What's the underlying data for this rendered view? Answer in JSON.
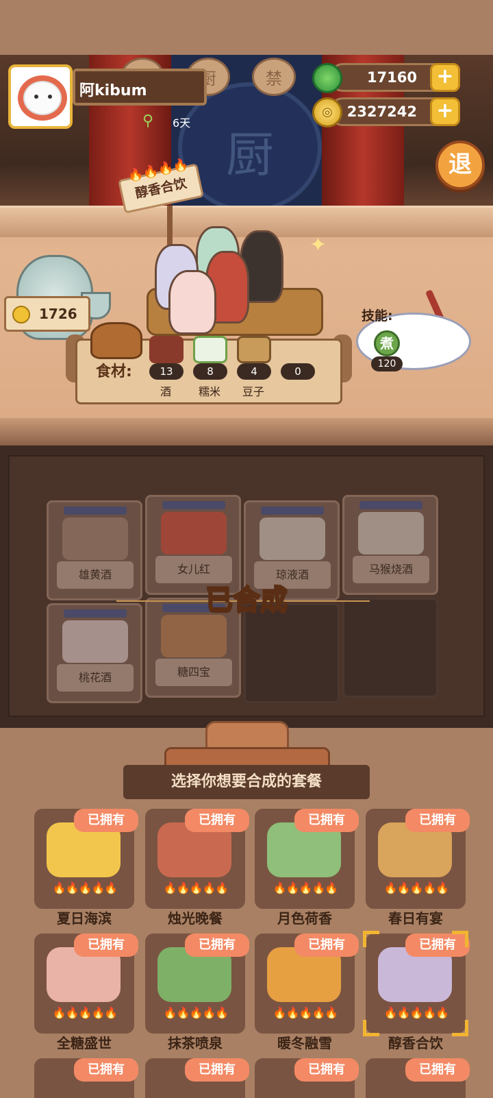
{
  "player": {
    "name": "阿kibum",
    "days": "6天"
  },
  "currency": {
    "jade": "17160",
    "coins": "2327242"
  },
  "exit_button": "退",
  "recipe": {
    "sign": "醇香合饮",
    "sign_flames": "🔥🔥🔥🔥",
    "price": "1726"
  },
  "ingredients": {
    "label": "食材:",
    "items": [
      {
        "name": "酒",
        "count": "13"
      },
      {
        "name": "糯米",
        "count": "8"
      },
      {
        "name": "豆子",
        "count": "4"
      },
      {
        "name": "",
        "count": "0"
      }
    ]
  },
  "skill": {
    "label": "技能:",
    "icon_char": "煮",
    "value": "120"
  },
  "synthesized": {
    "label": "已合成",
    "slots": [
      "雄黄酒",
      "女儿红",
      "琼液酒",
      "马猴烧酒",
      "桃花酒",
      "糖四宝"
    ]
  },
  "selection_banner": "选择你想要合成的套餐",
  "owned_label": "已拥有",
  "flames": "🔥🔥🔥🔥🔥",
  "menus": [
    {
      "name": "夏日海滨",
      "color": "#f2c64c"
    },
    {
      "name": "烛光晚餐",
      "color": "#c96a50"
    },
    {
      "name": "月色荷香",
      "color": "#8fbf7a"
    },
    {
      "name": "春日有宴",
      "color": "#d9a45b"
    },
    {
      "name": "全糖盛世",
      "color": "#e9b3a8"
    },
    {
      "name": "抹茶喷泉",
      "color": "#7fb068"
    },
    {
      "name": "暖冬融雪",
      "color": "#e6a042"
    },
    {
      "name": "醇香合饮",
      "color": "#c9b8d8"
    }
  ],
  "selected_menu": "醇香合饮",
  "colors": {
    "accent": "#f2b531",
    "owned_badge": "#f38a65",
    "panel": "#a98064"
  }
}
